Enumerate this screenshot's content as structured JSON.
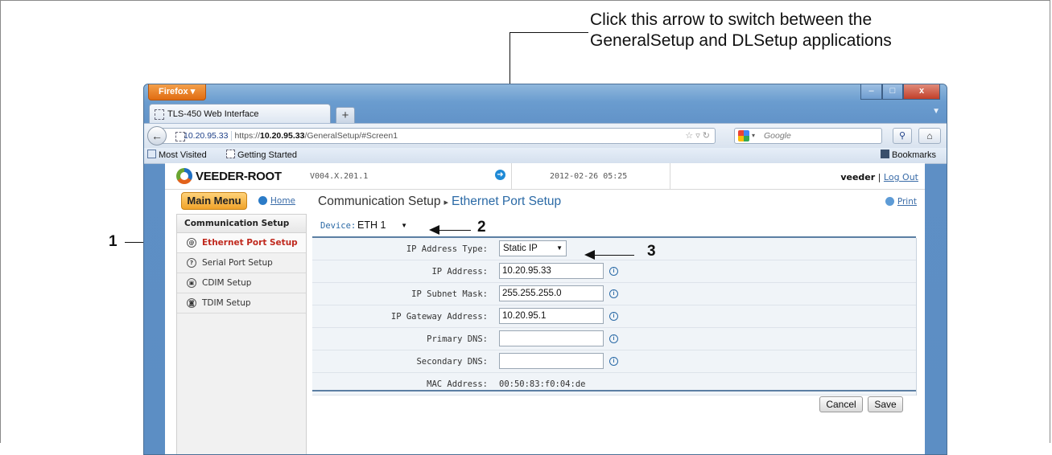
{
  "callout": {
    "line1": "Click this arrow to switch between the",
    "line2": "GeneralSetup and DLSetup applications"
  },
  "markers": {
    "m1": "1",
    "m2": "2",
    "m3": "3"
  },
  "browser": {
    "app_button": "Firefox",
    "tab_title": "TLS-450 Web Interface",
    "new_tab": "+",
    "url_identity": "10.20.95.33",
    "url_scheme": "https://",
    "url_host": "10.20.95.33",
    "url_path": "/GeneralSetup/#Screen1",
    "search_placeholder": "Google",
    "bookmarks": [
      "Most Visited",
      "Getting Started"
    ],
    "bookmarks_menu": "Bookmarks"
  },
  "header": {
    "brand": "VEEDER-ROOT",
    "version": "V004.X.201.1",
    "datetime": "2012-02-26 05:25",
    "user": "veeder",
    "separator": "|",
    "logout": "Log Out"
  },
  "titlebar": {
    "main_menu": "Main Menu",
    "home": "Home",
    "crumb_parent": "Communication Setup",
    "crumb_sep": "▸",
    "crumb_current": "Ethernet Port Setup",
    "print": "Print"
  },
  "sidebar": {
    "heading": "Communication Setup",
    "items": [
      {
        "label": "Ethernet Port Setup",
        "icon": "ethernet-icon",
        "active": true
      },
      {
        "label": "Serial Port Setup",
        "icon": "serial-icon",
        "active": false
      },
      {
        "label": "CDIM Setup",
        "icon": "cdim-icon",
        "active": false
      },
      {
        "label": "TDIM Setup",
        "icon": "tdim-icon",
        "active": false
      }
    ]
  },
  "device": {
    "label": "Device:",
    "value": "ETH 1"
  },
  "form": {
    "ip_type_label": "IP Address Type:",
    "ip_type_value": "Static IP",
    "ip_label": "IP Address:",
    "ip_value": "10.20.95.33",
    "mask_label": "IP Subnet Mask:",
    "mask_value": "255.255.255.0",
    "gateway_label": "IP Gateway Address:",
    "gateway_value": "10.20.95.1",
    "dns1_label": "Primary DNS:",
    "dns1_value": "",
    "dns2_label": "Secondary DNS:",
    "dns2_value": "",
    "mac_label": "MAC Address:",
    "mac_value": "00:50:83:f0:04:de"
  },
  "actions": {
    "cancel": "Cancel",
    "save": "Save"
  }
}
